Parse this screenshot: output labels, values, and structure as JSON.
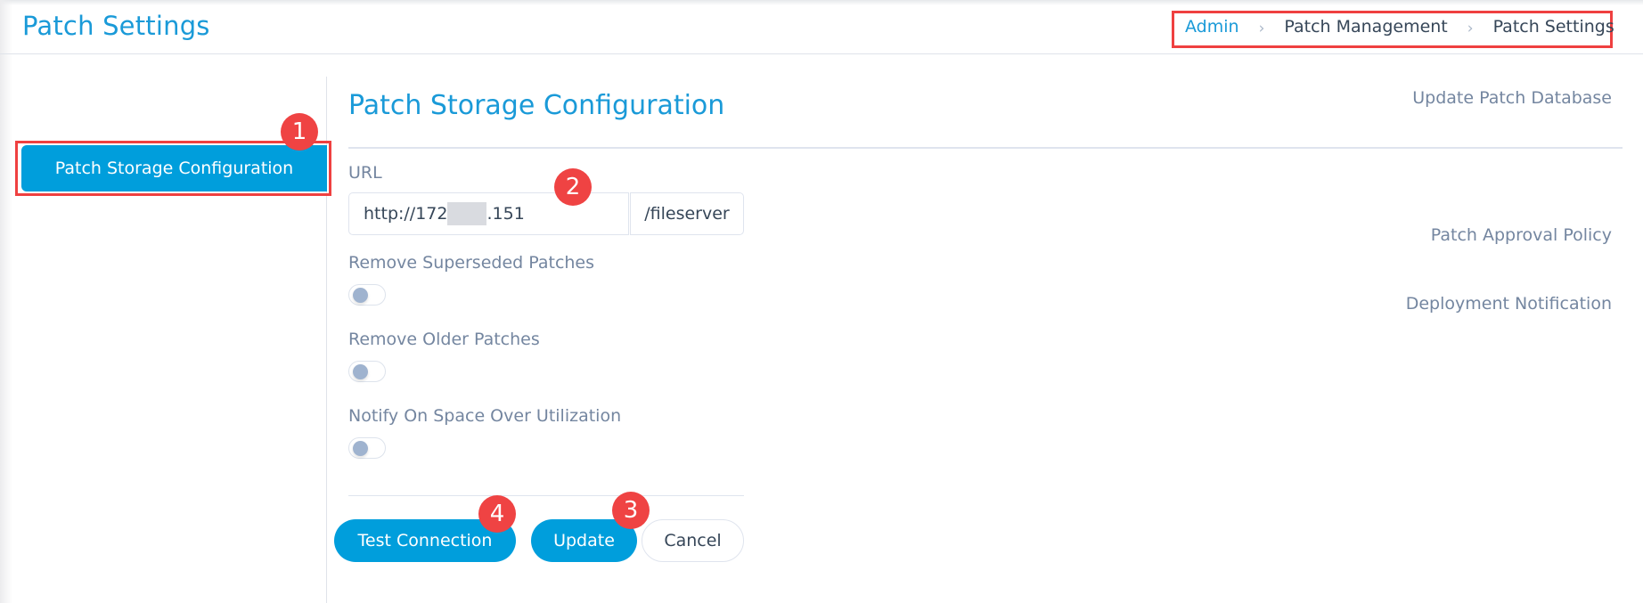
{
  "header": {
    "title": "Patch Settings",
    "breadcrumb": [
      {
        "label": "Admin",
        "link": true
      },
      {
        "label": "Patch Management",
        "link": false
      },
      {
        "label": "Patch Settings",
        "link": false
      }
    ],
    "separator": "›"
  },
  "sidebar": {
    "items": [
      {
        "label": "Update Patch Database",
        "active": false
      },
      {
        "label": "Patch Storage Configuration",
        "active": true
      },
      {
        "label": "Patch Approval Policy",
        "active": false
      },
      {
        "label": "Deployment Notification",
        "active": false
      }
    ]
  },
  "main": {
    "title": "Patch Storage Configuration",
    "url": {
      "label": "URL",
      "value_prefix": "http://172",
      "value_suffix": ".151",
      "redacted": true,
      "path_suffix": "/fileserver"
    },
    "toggles": [
      {
        "label": "Remove Superseded Patches",
        "on": false
      },
      {
        "label": "Remove Older Patches",
        "on": false
      },
      {
        "label": "Notify On Space Over Utilization",
        "on": false
      }
    ],
    "buttons": {
      "test_connection": "Test Connection",
      "update": "Update",
      "cancel": "Cancel"
    }
  },
  "annotations": {
    "badges": [
      "1",
      "2",
      "3",
      "4"
    ],
    "highlight_color": "#ef4040"
  },
  "colors": {
    "accent": "#009edc",
    "title": "#1a9ad8",
    "muted_text": "#7486a0",
    "badge": "#ef4343"
  }
}
